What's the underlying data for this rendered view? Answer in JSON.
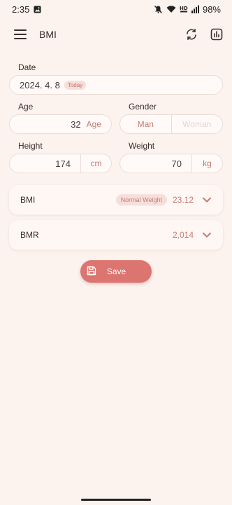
{
  "status_bar": {
    "time": "2:35",
    "battery": "98%",
    "icons": [
      "gallery-icon",
      "mute-icon",
      "wifi-icon",
      "hd-voice-icon",
      "signal-icon",
      "battery-icon"
    ]
  },
  "app_bar": {
    "title": "BMI",
    "icons": [
      "menu-icon",
      "refresh-icon",
      "chart-icon"
    ]
  },
  "form": {
    "date": {
      "label": "Date",
      "value": "2024. 4. 8",
      "badge": "Today"
    },
    "age": {
      "label": "Age",
      "value": "32",
      "unit": "Age"
    },
    "gender": {
      "label": "Gender",
      "options": [
        "Man",
        "Woman"
      ],
      "selected": "Man"
    },
    "height": {
      "label": "Height",
      "value": "174",
      "unit": "cm"
    },
    "weight": {
      "label": "Weight",
      "value": "70",
      "unit": "kg"
    }
  },
  "results": {
    "bmi": {
      "title": "BMI",
      "badge": "Normal Weight",
      "value": "23.12"
    },
    "bmr": {
      "title": "BMR",
      "value": "2,014"
    }
  },
  "save": {
    "label": "Save"
  },
  "colors": {
    "background": "#fcf2ee",
    "accent": "#dc7470",
    "accent_text": "#c77a74"
  }
}
